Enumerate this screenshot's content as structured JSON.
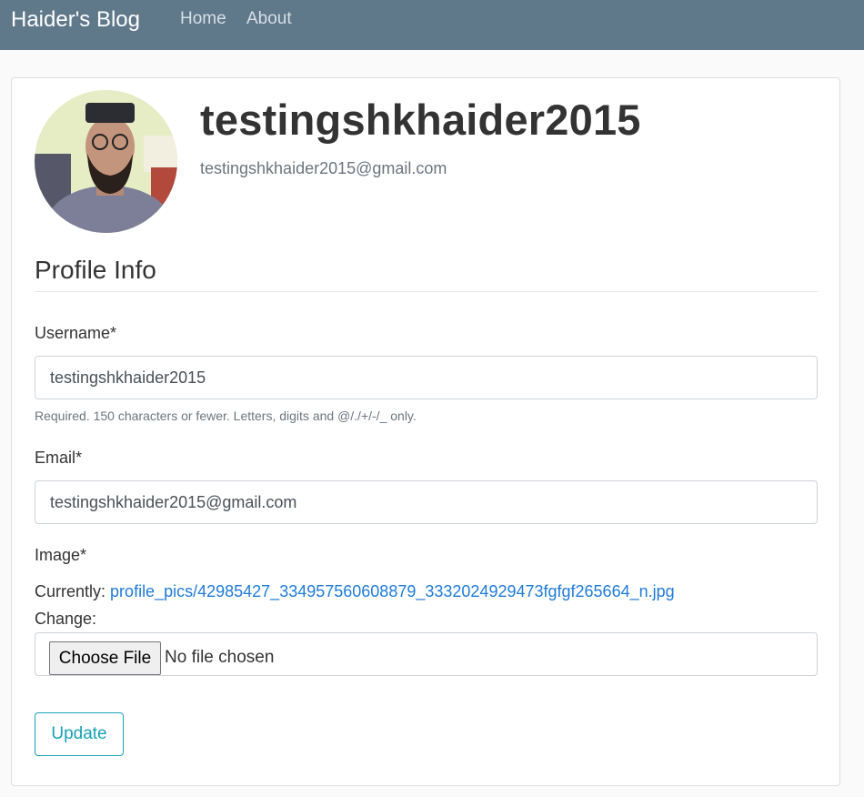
{
  "navbar": {
    "brand": "Haider's Blog",
    "links": [
      "Home",
      "About"
    ]
  },
  "profile": {
    "username": "testingshkhaider2015",
    "email": "testingshkhaider2015@gmail.com"
  },
  "form": {
    "section_title": "Profile Info",
    "username_label": "Username*",
    "username_value": "testingshkhaider2015",
    "username_help": "Required. 150 characters or fewer. Letters, digits and @/./+/-/_ only.",
    "email_label": "Email*",
    "email_value": "testingshkhaider2015@gmail.com",
    "image_label": "Image*",
    "currently_label": "Currently:",
    "current_file": "profile_pics/42985427_334957560608879_3332024929473fgfgf265664_n.jpg",
    "change_label": "Change:",
    "choose_file_label": "Choose File",
    "no_file_text": "No file chosen",
    "submit_label": "Update"
  },
  "colors": {
    "navbar_bg": "#5f788a",
    "accent": "#17a2b8",
    "link": "#1f7bd8"
  }
}
